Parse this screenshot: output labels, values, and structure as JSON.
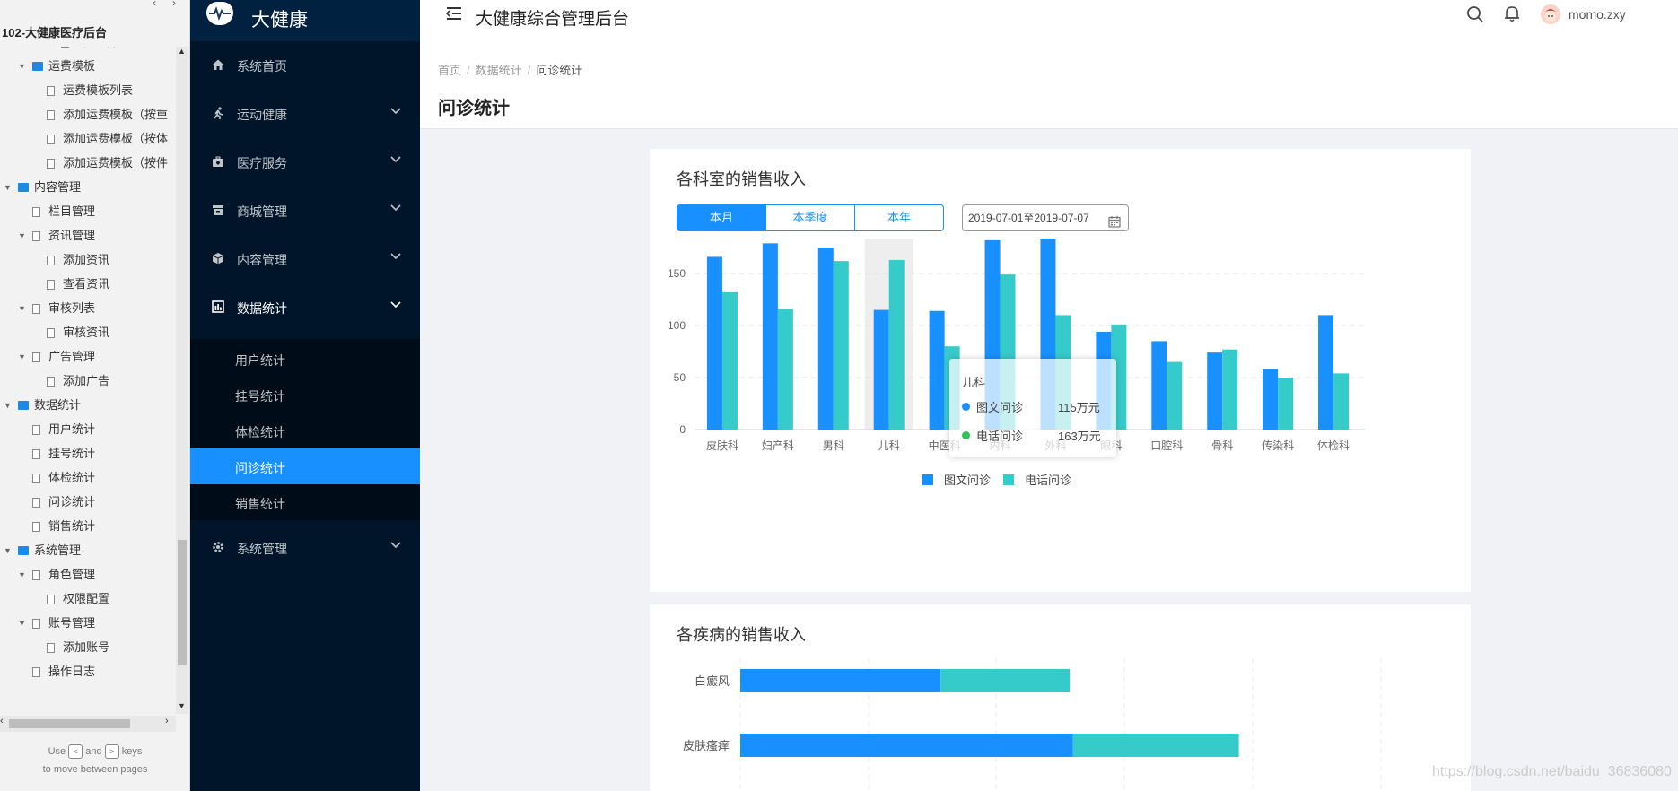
{
  "tree": {
    "title": "102-大健康医疗后台",
    "items": [
      {
        "label": "评价详情",
        "level": 3,
        "type": "page",
        "toggle": ""
      },
      {
        "label": "运费模板",
        "level": 1,
        "type": "folder",
        "toggle": "▼"
      },
      {
        "label": "运费模板列表",
        "level": 2,
        "type": "page",
        "toggle": ""
      },
      {
        "label": "添加运费模板（按重",
        "level": 2,
        "type": "page",
        "toggle": ""
      },
      {
        "label": "添加运费模板（按体",
        "level": 2,
        "type": "page",
        "toggle": ""
      },
      {
        "label": "添加运费模板（按件",
        "level": 2,
        "type": "page",
        "toggle": ""
      },
      {
        "label": "内容管理",
        "level": 0,
        "type": "folder",
        "toggle": "▼"
      },
      {
        "label": "栏目管理",
        "level": 1,
        "type": "page",
        "toggle": ""
      },
      {
        "label": "资讯管理",
        "level": 1,
        "type": "page",
        "toggle": "▼"
      },
      {
        "label": "添加资讯",
        "level": 2,
        "type": "page",
        "toggle": ""
      },
      {
        "label": "查看资讯",
        "level": 2,
        "type": "page",
        "toggle": ""
      },
      {
        "label": "审核列表",
        "level": 1,
        "type": "page",
        "toggle": "▼"
      },
      {
        "label": "审核资讯",
        "level": 2,
        "type": "page",
        "toggle": ""
      },
      {
        "label": "广告管理",
        "level": 1,
        "type": "page",
        "toggle": "▼"
      },
      {
        "label": "添加广告",
        "level": 2,
        "type": "page",
        "toggle": ""
      },
      {
        "label": "数据统计",
        "level": 0,
        "type": "folder",
        "toggle": "▼"
      },
      {
        "label": "用户统计",
        "level": 1,
        "type": "page",
        "toggle": ""
      },
      {
        "label": "挂号统计",
        "level": 1,
        "type": "page",
        "toggle": ""
      },
      {
        "label": "体检统计",
        "level": 1,
        "type": "page",
        "toggle": ""
      },
      {
        "label": "问诊统计",
        "level": 1,
        "type": "page",
        "toggle": ""
      },
      {
        "label": "销售统计",
        "level": 1,
        "type": "page",
        "toggle": ""
      },
      {
        "label": "系统管理",
        "level": 0,
        "type": "folder",
        "toggle": "▼"
      },
      {
        "label": "角色管理",
        "level": 1,
        "type": "page",
        "toggle": "▼"
      },
      {
        "label": "权限配置",
        "level": 2,
        "type": "page",
        "toggle": ""
      },
      {
        "label": "账号管理",
        "level": 1,
        "type": "page",
        "toggle": "▼"
      },
      {
        "label": "添加账号",
        "level": 2,
        "type": "page",
        "toggle": ""
      },
      {
        "label": "操作日志",
        "level": 1,
        "type": "page",
        "toggle": ""
      }
    ],
    "hint_use": "Use",
    "hint_and": "and",
    "hint_keys": "keys",
    "hint_line2": "to move between pages",
    "key_left": "<",
    "key_right": ">"
  },
  "sidebar": {
    "brand": "大健康",
    "menu": [
      {
        "label": "系统首页",
        "icon": "home-icon",
        "chevron": false
      },
      {
        "label": "运动健康",
        "icon": "run-icon",
        "chevron": true
      },
      {
        "label": "医疗服务",
        "icon": "medkit-icon",
        "chevron": true
      },
      {
        "label": "商城管理",
        "icon": "store-icon",
        "chevron": true
      },
      {
        "label": "内容管理",
        "icon": "box-icon",
        "chevron": true
      },
      {
        "label": "数据统计",
        "icon": "chart-icon",
        "chevron": true,
        "open": true
      }
    ],
    "submenu": [
      {
        "label": "用户统计"
      },
      {
        "label": "挂号统计"
      },
      {
        "label": "体检统计"
      },
      {
        "label": "问诊统计",
        "active": true
      },
      {
        "label": "销售统计"
      }
    ],
    "system": {
      "label": "系统管理",
      "icon": "gear-icon"
    }
  },
  "header": {
    "title": "大健康综合管理后台",
    "user": "momo.zxy"
  },
  "breadcrumb": [
    "首页",
    "数据统计",
    "问诊统计"
  ],
  "page_title": "问诊统计",
  "card1": {
    "title": "各科室的销售收入",
    "segments": [
      {
        "label": "本月",
        "active": true
      },
      {
        "label": "本季度",
        "active": false
      },
      {
        "label": "本年",
        "active": false
      }
    ],
    "date_range": "2019-07-01至2019-07-07"
  },
  "card2": {
    "title": "各疾病的销售收入"
  },
  "tooltip": {
    "title": "儿科",
    "rows": [
      {
        "name": "图文问诊",
        "value": "115万元",
        "color": "#1890ff"
      },
      {
        "name": "电话问诊",
        "value": "163万元",
        "color": "#2fc25b"
      }
    ]
  },
  "watermark": "https://blog.csdn.net/baidu_36836080",
  "colors": {
    "series1": "#1890ff",
    "series2": "#36cbcb",
    "accent": "#1890ff",
    "sidebar": "#001529"
  },
  "chart_data": [
    {
      "type": "bar",
      "title": "各科室的销售收入",
      "categories": [
        "皮肤科",
        "妇产科",
        "男科",
        "儿科",
        "中医科",
        "内科",
        "外科",
        "眼科",
        "口腔科",
        "骨科",
        "传染科",
        "体检科"
      ],
      "series": [
        {
          "name": "图文问诊",
          "values": [
            166,
            179,
            175,
            115,
            114,
            182,
            188,
            94,
            85,
            74,
            58,
            110
          ]
        },
        {
          "name": "电话问诊",
          "values": [
            132,
            116,
            162,
            163,
            80,
            149,
            110,
            101,
            65,
            77,
            50,
            54
          ]
        }
      ],
      "ylim": [
        0,
        200
      ],
      "yticks": [
        0,
        50,
        100,
        150,
        200
      ],
      "highlight_category": "儿科",
      "legend": "bottom",
      "grid": true
    },
    {
      "type": "bar",
      "orientation": "horizontal",
      "stacked": true,
      "title": "各疾病的销售收入",
      "categories": [
        "白癜风",
        "皮肤瘙痒"
      ],
      "series": [
        {
          "name": "图文问诊",
          "values": [
            186,
            309
          ]
        },
        {
          "name": "电话问诊",
          "values": [
            120,
            154
          ]
        }
      ],
      "xlim": [
        0,
        500
      ]
    }
  ]
}
